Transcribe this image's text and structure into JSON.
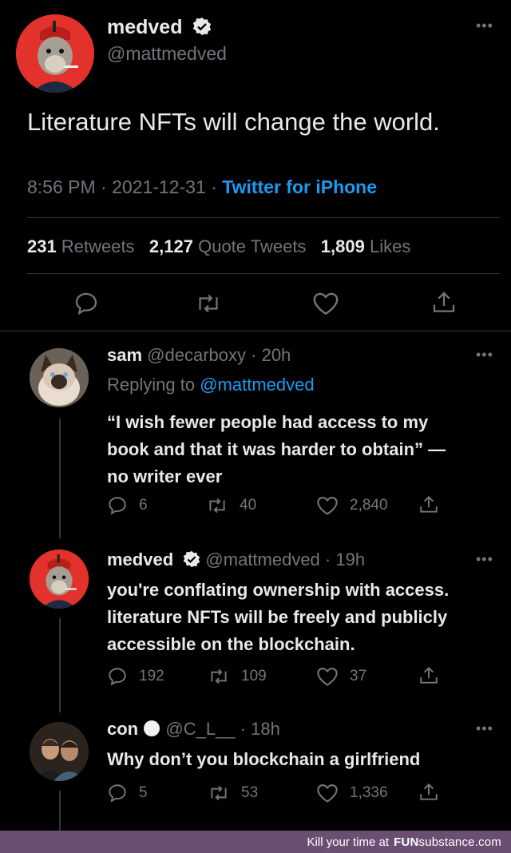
{
  "main_tweet": {
    "author_name": "medved",
    "handle": "@mattmedved",
    "text": "Literature NFTs will change the world.",
    "time": "8:56 PM",
    "separator": "·",
    "date": "2021-12-31",
    "source": "Twitter for iPhone",
    "retweets_count": "231",
    "retweets_label": "Retweets",
    "quotes_count": "2,127",
    "quotes_label": "Quote Tweets",
    "likes_count": "1,809",
    "likes_label": "Likes"
  },
  "replies": [
    {
      "author_name": "sam",
      "handle": "@decarboxy",
      "time": "· 20h",
      "replying_label": "Replying to",
      "replying_handle": "@mattmedved",
      "text_lines": [
        "“I wish fewer people had access to my",
        "book and that it was harder to obtain” —",
        "no writer ever"
      ],
      "replies_count": "6",
      "retweets_count": "40",
      "likes_count": "2,840"
    },
    {
      "author_name": "medved",
      "handle": "@mattmedved",
      "time": "· 19h",
      "text_lines": [
        "you're conflating ownership with access.",
        "literature NFTs will be freely and publicly",
        "accessible on the blockchain."
      ],
      "replies_count": "192",
      "retweets_count": "109",
      "likes_count": "37"
    },
    {
      "author_name": "con",
      "handle": "@C_L__",
      "time": "· 18h",
      "text_lines": [
        "Why don’t you blockchain a girlfriend"
      ],
      "replies_count": "5",
      "retweets_count": "53",
      "likes_count": "1,336"
    }
  ],
  "footer": {
    "tagline": "Kill your time at",
    "brand_fun": "FUN",
    "brand_rest": "substance.com"
  },
  "colors": {
    "background": "#000000",
    "text": "#e7e9ea",
    "muted": "#71767b",
    "link": "#1d9bf0",
    "avatar_red": "#e2322b",
    "footer_bar": "#6b4f73"
  }
}
